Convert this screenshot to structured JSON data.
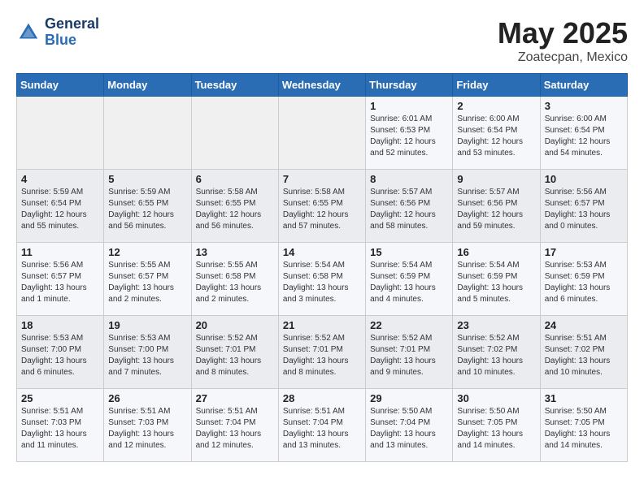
{
  "header": {
    "logo_general": "General",
    "logo_blue": "Blue",
    "title": "May 2025",
    "subtitle": "Zoatecpan, Mexico"
  },
  "weekdays": [
    "Sunday",
    "Monday",
    "Tuesday",
    "Wednesday",
    "Thursday",
    "Friday",
    "Saturday"
  ],
  "weeks": [
    [
      {
        "day": "",
        "info": ""
      },
      {
        "day": "",
        "info": ""
      },
      {
        "day": "",
        "info": ""
      },
      {
        "day": "",
        "info": ""
      },
      {
        "day": "1",
        "info": "Sunrise: 6:01 AM\nSunset: 6:53 PM\nDaylight: 12 hours\nand 52 minutes."
      },
      {
        "day": "2",
        "info": "Sunrise: 6:00 AM\nSunset: 6:54 PM\nDaylight: 12 hours\nand 53 minutes."
      },
      {
        "day": "3",
        "info": "Sunrise: 6:00 AM\nSunset: 6:54 PM\nDaylight: 12 hours\nand 54 minutes."
      }
    ],
    [
      {
        "day": "4",
        "info": "Sunrise: 5:59 AM\nSunset: 6:54 PM\nDaylight: 12 hours\nand 55 minutes."
      },
      {
        "day": "5",
        "info": "Sunrise: 5:59 AM\nSunset: 6:55 PM\nDaylight: 12 hours\nand 56 minutes."
      },
      {
        "day": "6",
        "info": "Sunrise: 5:58 AM\nSunset: 6:55 PM\nDaylight: 12 hours\nand 56 minutes."
      },
      {
        "day": "7",
        "info": "Sunrise: 5:58 AM\nSunset: 6:55 PM\nDaylight: 12 hours\nand 57 minutes."
      },
      {
        "day": "8",
        "info": "Sunrise: 5:57 AM\nSunset: 6:56 PM\nDaylight: 12 hours\nand 58 minutes."
      },
      {
        "day": "9",
        "info": "Sunrise: 5:57 AM\nSunset: 6:56 PM\nDaylight: 12 hours\nand 59 minutes."
      },
      {
        "day": "10",
        "info": "Sunrise: 5:56 AM\nSunset: 6:57 PM\nDaylight: 13 hours\nand 0 minutes."
      }
    ],
    [
      {
        "day": "11",
        "info": "Sunrise: 5:56 AM\nSunset: 6:57 PM\nDaylight: 13 hours\nand 1 minute."
      },
      {
        "day": "12",
        "info": "Sunrise: 5:55 AM\nSunset: 6:57 PM\nDaylight: 13 hours\nand 2 minutes."
      },
      {
        "day": "13",
        "info": "Sunrise: 5:55 AM\nSunset: 6:58 PM\nDaylight: 13 hours\nand 2 minutes."
      },
      {
        "day": "14",
        "info": "Sunrise: 5:54 AM\nSunset: 6:58 PM\nDaylight: 13 hours\nand 3 minutes."
      },
      {
        "day": "15",
        "info": "Sunrise: 5:54 AM\nSunset: 6:59 PM\nDaylight: 13 hours\nand 4 minutes."
      },
      {
        "day": "16",
        "info": "Sunrise: 5:54 AM\nSunset: 6:59 PM\nDaylight: 13 hours\nand 5 minutes."
      },
      {
        "day": "17",
        "info": "Sunrise: 5:53 AM\nSunset: 6:59 PM\nDaylight: 13 hours\nand 6 minutes."
      }
    ],
    [
      {
        "day": "18",
        "info": "Sunrise: 5:53 AM\nSunset: 7:00 PM\nDaylight: 13 hours\nand 6 minutes."
      },
      {
        "day": "19",
        "info": "Sunrise: 5:53 AM\nSunset: 7:00 PM\nDaylight: 13 hours\nand 7 minutes."
      },
      {
        "day": "20",
        "info": "Sunrise: 5:52 AM\nSunset: 7:01 PM\nDaylight: 13 hours\nand 8 minutes."
      },
      {
        "day": "21",
        "info": "Sunrise: 5:52 AM\nSunset: 7:01 PM\nDaylight: 13 hours\nand 8 minutes."
      },
      {
        "day": "22",
        "info": "Sunrise: 5:52 AM\nSunset: 7:01 PM\nDaylight: 13 hours\nand 9 minutes."
      },
      {
        "day": "23",
        "info": "Sunrise: 5:52 AM\nSunset: 7:02 PM\nDaylight: 13 hours\nand 10 minutes."
      },
      {
        "day": "24",
        "info": "Sunrise: 5:51 AM\nSunset: 7:02 PM\nDaylight: 13 hours\nand 10 minutes."
      }
    ],
    [
      {
        "day": "25",
        "info": "Sunrise: 5:51 AM\nSunset: 7:03 PM\nDaylight: 13 hours\nand 11 minutes."
      },
      {
        "day": "26",
        "info": "Sunrise: 5:51 AM\nSunset: 7:03 PM\nDaylight: 13 hours\nand 12 minutes."
      },
      {
        "day": "27",
        "info": "Sunrise: 5:51 AM\nSunset: 7:04 PM\nDaylight: 13 hours\nand 12 minutes."
      },
      {
        "day": "28",
        "info": "Sunrise: 5:51 AM\nSunset: 7:04 PM\nDaylight: 13 hours\nand 13 minutes."
      },
      {
        "day": "29",
        "info": "Sunrise: 5:50 AM\nSunset: 7:04 PM\nDaylight: 13 hours\nand 13 minutes."
      },
      {
        "day": "30",
        "info": "Sunrise: 5:50 AM\nSunset: 7:05 PM\nDaylight: 13 hours\nand 14 minutes."
      },
      {
        "day": "31",
        "info": "Sunrise: 5:50 AM\nSunset: 7:05 PM\nDaylight: 13 hours\nand 14 minutes."
      }
    ]
  ]
}
